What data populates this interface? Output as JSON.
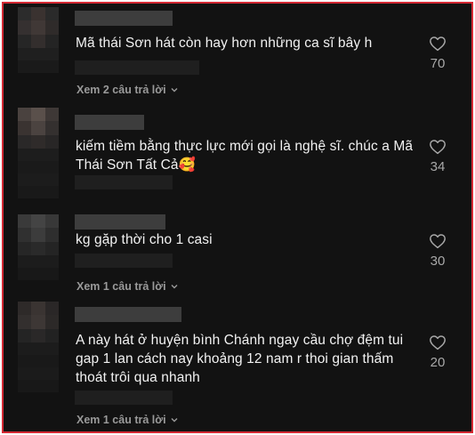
{
  "comments": [
    {
      "text": "Mã thái Sơn hát còn hay hơn những ca sĩ bây h",
      "likes": "70",
      "replies_label": "Xem 2 câu trả lời"
    },
    {
      "text": "kiếm tiềm bằng thực lực mới gọi là nghệ sĩ. chúc a Mã Thái Sơn Tất Cả🥰",
      "likes": "34",
      "replies_label": ""
    },
    {
      "text": "kg gặp thời cho 1 casi",
      "likes": "30",
      "replies_label": "Xem 1 câu trả lời"
    },
    {
      "text": "A này hát ở huyện bình Chánh ngay cầu chợ đệm tui gap 1 lan cách nay khoảng 12 nam r thoi gian thấm thoát trôi qua nhanh",
      "likes": "20",
      "replies_label": "Xem 1 câu trả lời"
    }
  ],
  "icons": {
    "like": "heart-outline-icon",
    "expand": "chevron-down-icon"
  },
  "colors": {
    "background": "#121212",
    "border": "#d42a34",
    "text": "#f2f2f2",
    "muted": "#9a9a9a"
  }
}
